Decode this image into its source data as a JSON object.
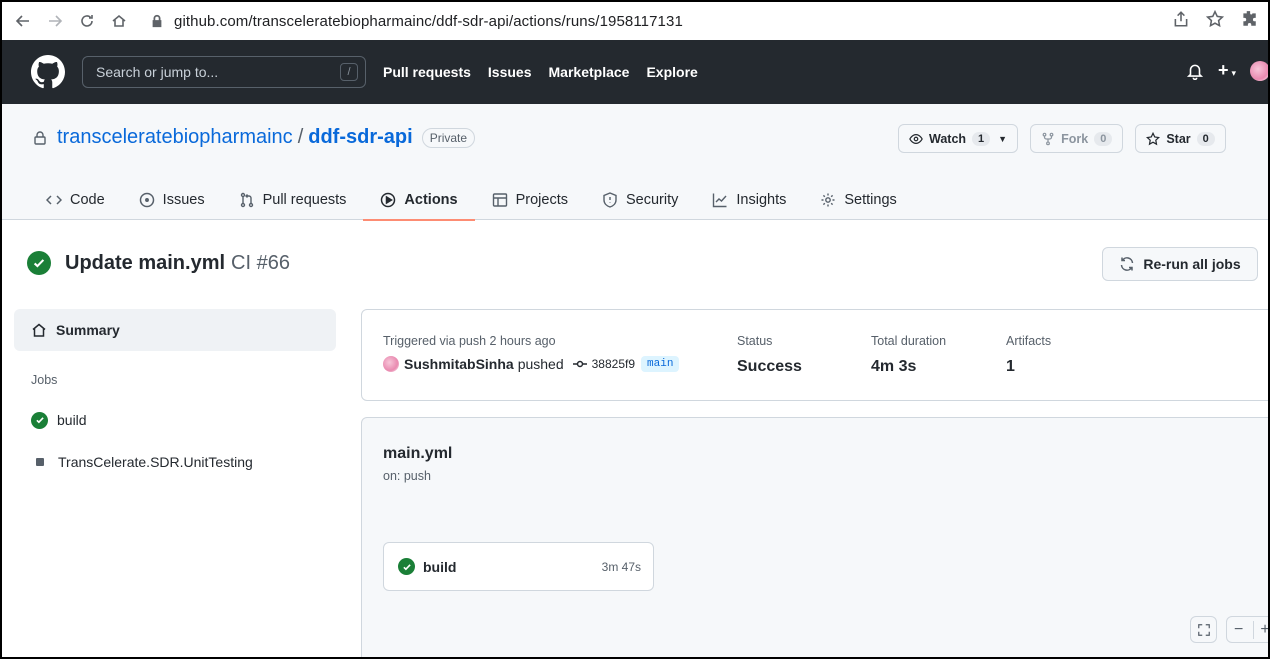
{
  "browser": {
    "url": "github.com/transceleratebiopharmainc/ddf-sdr-api/actions/runs/1958117131"
  },
  "header": {
    "search_placeholder": "Search or jump to...",
    "search_shortcut": "/",
    "nav": [
      "Pull requests",
      "Issues",
      "Marketplace",
      "Explore"
    ]
  },
  "repo": {
    "owner": "transceleratebiopharmainc",
    "separator": "/",
    "name": "ddf-sdr-api",
    "visibility": "Private",
    "watch_label": "Watch",
    "watch_count": "1",
    "fork_label": "Fork",
    "fork_count": "0",
    "star_label": "Star",
    "star_count": "0",
    "tabs": [
      {
        "label": "Code",
        "icon": "code-icon"
      },
      {
        "label": "Issues",
        "icon": "issue-icon"
      },
      {
        "label": "Pull requests",
        "icon": "pull-request-icon"
      },
      {
        "label": "Actions",
        "icon": "play-icon",
        "active": true
      },
      {
        "label": "Projects",
        "icon": "table-icon"
      },
      {
        "label": "Security",
        "icon": "shield-icon"
      },
      {
        "label": "Insights",
        "icon": "graph-icon"
      },
      {
        "label": "Settings",
        "icon": "gear-icon"
      }
    ]
  },
  "run": {
    "title": "Update main.yml",
    "meta": "CI #66",
    "rerun_label": "Re-run all jobs"
  },
  "sidebar": {
    "summary_label": "Summary",
    "jobs_heading": "Jobs",
    "jobs": [
      {
        "name": "build",
        "status": "success"
      },
      {
        "name": "TransCelerate.SDR.UnitTesting",
        "status": "skipped"
      }
    ]
  },
  "summary": {
    "trigger_label": "Triggered via push 2 hours ago",
    "user": "SushmitabSinha",
    "action": "pushed",
    "sha": "38825f9",
    "branch": "main",
    "status_label": "Status",
    "status_value": "Success",
    "duration_label": "Total duration",
    "duration_value": "4m 3s",
    "artifacts_label": "Artifacts",
    "artifacts_value": "1"
  },
  "workflow": {
    "file": "main.yml",
    "trigger": "on: push",
    "job_name": "build",
    "job_duration": "3m 47s"
  },
  "colors": {
    "header_bg": "#24292f",
    "success": "#1a7f37",
    "link": "#0969da",
    "active_tab_underline": "#fd8c73"
  }
}
